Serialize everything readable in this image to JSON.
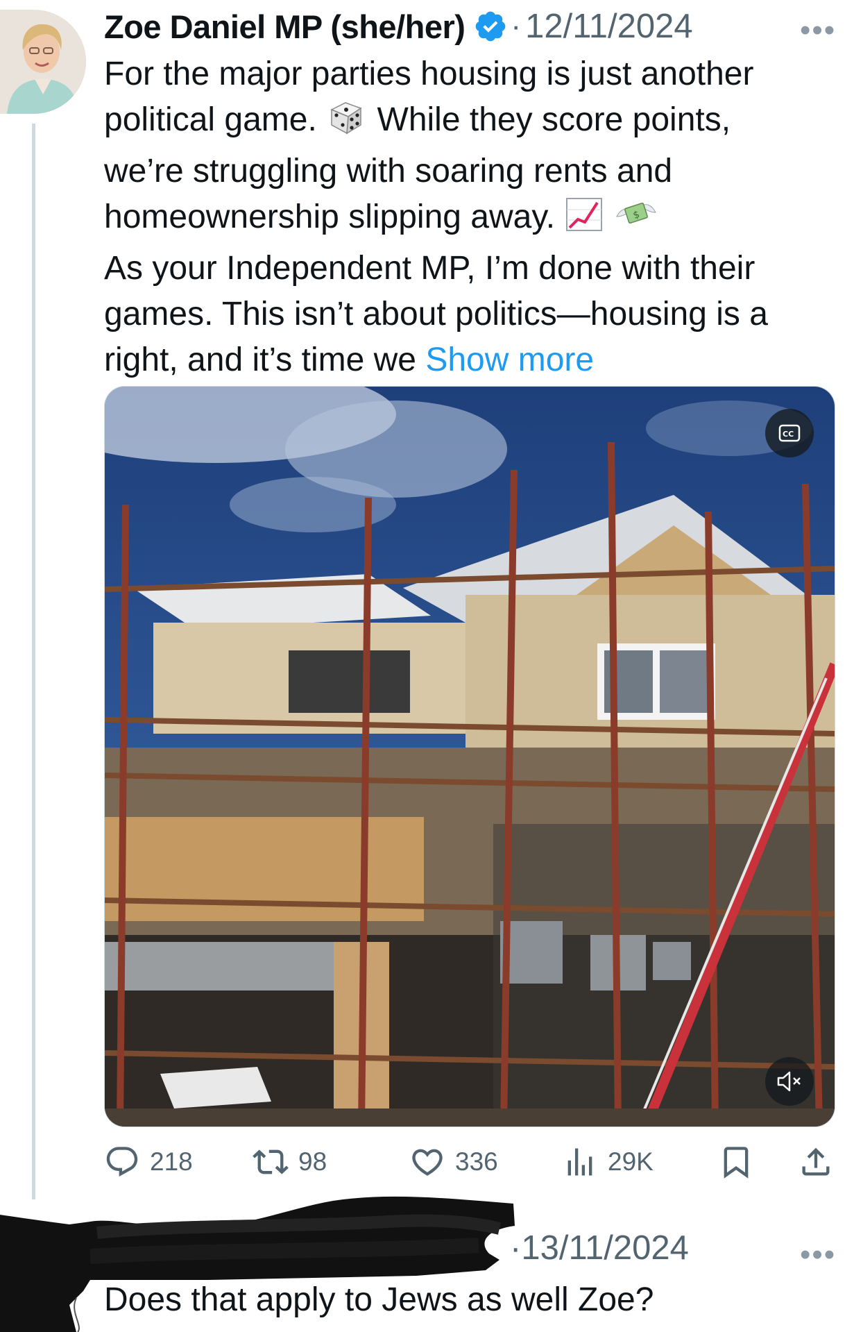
{
  "tweet": {
    "author_name": "Zoe Daniel MP (she/her)",
    "separator": "·",
    "date": "12/11/2024",
    "more": "•••",
    "text_lines": [
      "For the major parties housing is just another",
      "political game.",
      "While they score points,",
      "we’re struggling with soaring rents and",
      "homeownership slipping away.",
      "As your Independent MP, I’m done with their",
      "games. This isn’t about politics—housing is a",
      "right, and it’s time we"
    ],
    "show_more": "Show more",
    "emojis": [
      "dice-emoji",
      "chart-increasing-emoji",
      "money-with-wings-emoji"
    ]
  },
  "media": {
    "type": "video",
    "cc_label": "CC",
    "icons": [
      "closed-captions-icon",
      "muted-speaker-icon"
    ]
  },
  "actions": {
    "replies": "218",
    "reposts": "98",
    "likes": "336",
    "views": "29K"
  },
  "reply": {
    "date_prefix": "·",
    "date": "13/11/2024",
    "more": "•••",
    "text": "Does that apply to Jews as well Zoe?"
  },
  "colors": {
    "accent": "#1d9bf0",
    "secondary_text": "#536471",
    "thread_line": "#cfd9de"
  }
}
